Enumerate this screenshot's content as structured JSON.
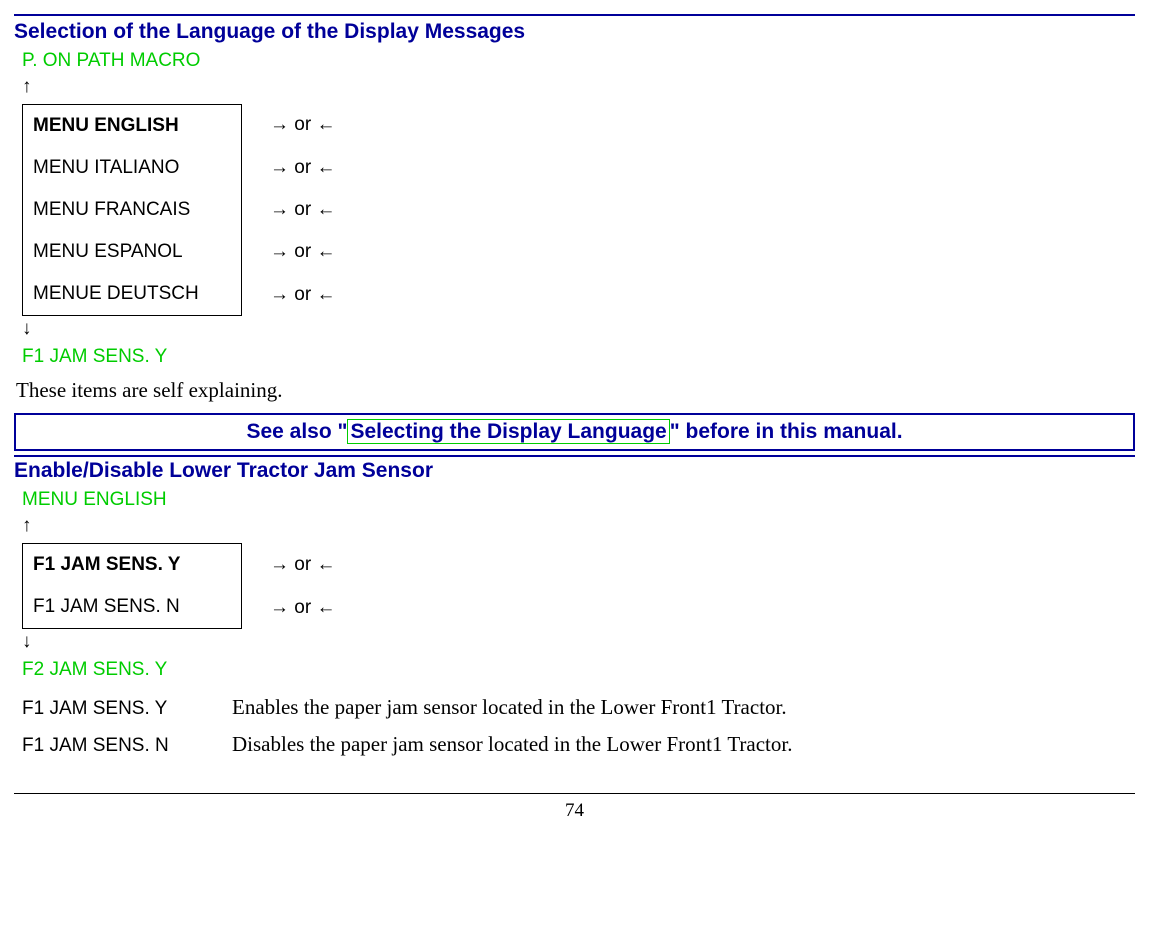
{
  "section1": {
    "title": "Selection of the Language of the Display Messages",
    "prev": "P. ON PATH MACRO",
    "up_arrow": "↑",
    "down_arrow": "↓",
    "next": "F1 JAM SENS. Y",
    "items": [
      {
        "label": "MENU ENGLISH",
        "bold": true,
        "hint": "→ or ←"
      },
      {
        "label": "MENU ITALIANO",
        "bold": false,
        "hint": "→ or ←"
      },
      {
        "label": "MENU FRANCAIS",
        "bold": false,
        "hint": "→ or ←"
      },
      {
        "label": "MENU ESPANOL",
        "bold": false,
        "hint": "→ or ←"
      },
      {
        "label": "MENUE DEUTSCH",
        "bold": false,
        "hint": "→ or ←"
      }
    ],
    "body": "These items are self explaining."
  },
  "note": {
    "before": "See also \"",
    "link": "Selecting the Display Language",
    "after": "\" before in this manual."
  },
  "section2": {
    "title": "Enable/Disable Lower Tractor Jam Sensor",
    "prev": "MENU ENGLISH",
    "up_arrow": "↑",
    "down_arrow": "↓",
    "next": "F2  JAM SENS. Y",
    "items": [
      {
        "label": "F1 JAM SENS. Y",
        "bold": true,
        "hint": "→ or ←"
      },
      {
        "label": "F1 JAM SENS. N",
        "bold": false,
        "hint": "→ or ←"
      }
    ],
    "descriptions": [
      {
        "label": "F1 JAM SENS. Y",
        "text": "Enables the paper jam sensor located in the Lower Front1 Tractor."
      },
      {
        "label": "F1 JAM SENS. N",
        "text": "Disables the paper jam sensor located in the Lower Front1 Tractor."
      }
    ]
  },
  "page_number": "74"
}
